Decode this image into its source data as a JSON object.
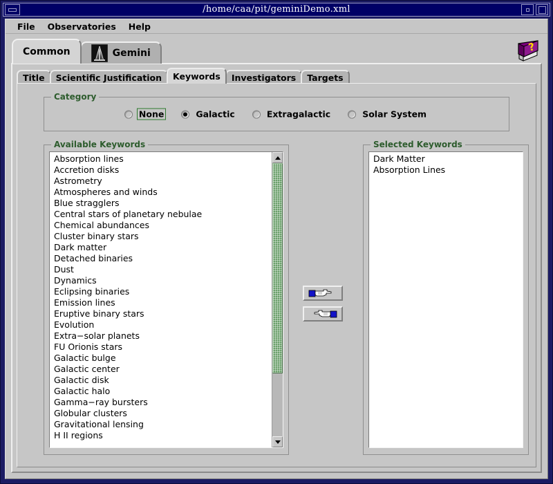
{
  "window": {
    "title": "/home/caa/pit/geminiDemo.xml",
    "controls": {
      "menu_button": "window-menu",
      "minimize": "minimize",
      "maximize": "maximize"
    }
  },
  "menubar": {
    "items": [
      {
        "label": "File"
      },
      {
        "label": "Observatories"
      },
      {
        "label": "Help"
      }
    ]
  },
  "help_icon": {
    "name": "help-book-icon"
  },
  "outer_tabs": [
    {
      "label": "Common",
      "selected": true,
      "icon": null
    },
    {
      "label": "Gemini",
      "selected": false,
      "icon": "telescope-icon"
    }
  ],
  "inner_tabs": [
    {
      "label": "Title",
      "selected": false
    },
    {
      "label": "Scientific Justification",
      "selected": false
    },
    {
      "label": "Keywords",
      "selected": true
    },
    {
      "label": "Investigators",
      "selected": false
    },
    {
      "label": "Targets",
      "selected": false
    }
  ],
  "category": {
    "legend": "Category",
    "options": [
      {
        "label": "None",
        "selected": false,
        "focused": true
      },
      {
        "label": "Galactic",
        "selected": true,
        "focused": false
      },
      {
        "label": "Extragalactic",
        "selected": false,
        "focused": false
      },
      {
        "label": "Solar System",
        "selected": false,
        "focused": false
      }
    ]
  },
  "available_keywords": {
    "legend": "Available Keywords",
    "items": [
      "Absorption lines",
      "Accretion disks",
      "Astrometry",
      "Atmospheres and winds",
      "Blue stragglers",
      "Central stars of planetary nebulae",
      "Chemical abundances",
      "Cluster binary stars",
      "Dark matter",
      "Detached binaries",
      "Dust",
      "Dynamics",
      "Eclipsing binaries",
      "Emission lines",
      "Eruptive binary stars",
      "Evolution",
      "Extra−solar planets",
      "FU Orionis stars",
      "Galactic bulge",
      "Galactic center",
      "Galactic disk",
      "Galactic halo",
      "Gamma−ray bursters",
      "Globular clusters",
      "Gravitational lensing",
      "H II regions"
    ],
    "scrollbar": {
      "up_arrow": "scroll-up-arrow",
      "down_arrow": "scroll-down-arrow",
      "thumb_color": "#6ba06b"
    }
  },
  "selected_keywords": {
    "legend": "Selected Keywords",
    "items": [
      "Dark Matter",
      "Absorption Lines"
    ]
  },
  "transfer_buttons": [
    {
      "name": "add-keyword-button",
      "direction": "right"
    },
    {
      "name": "remove-keyword-button",
      "direction": "left"
    }
  ],
  "colors": {
    "titlebar": "#000066",
    "face": "#c6c6c6",
    "legend_text": "#2d5c2d",
    "focus_border": "#2d7a2d",
    "scroll_thumb": "#6ba06b",
    "help_book": "#800080",
    "help_question": "#ffd700"
  }
}
